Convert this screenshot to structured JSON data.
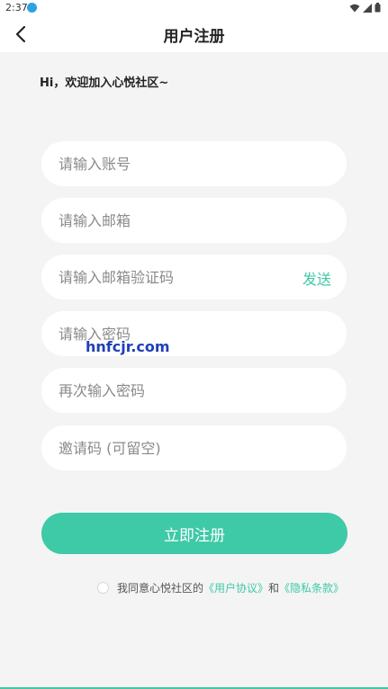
{
  "status_bar": {
    "time": "2:37"
  },
  "header": {
    "title": "用户注册",
    "back_icon": "chevron-left-icon"
  },
  "welcome": "Hi，欢迎加入心悦社区~",
  "form": {
    "account_placeholder": "请输入账号",
    "email_placeholder": "请输入邮箱",
    "code_placeholder": "请输入邮箱验证码",
    "send_label": "发送",
    "password_placeholder": "请输入密码",
    "confirm_password_placeholder": "再次输入密码",
    "invite_placeholder": "邀请码 (可留空)"
  },
  "watermark": "hnfcjr.com",
  "submit_label": "立即注册",
  "agreement": {
    "prefix": "我同意心悦社区的",
    "user_agreement": "《用户协议》",
    "and": "和",
    "privacy_policy": "《隐私条款》"
  },
  "colors": {
    "accent": "#3ec9a7",
    "background": "#f4f4f4"
  }
}
